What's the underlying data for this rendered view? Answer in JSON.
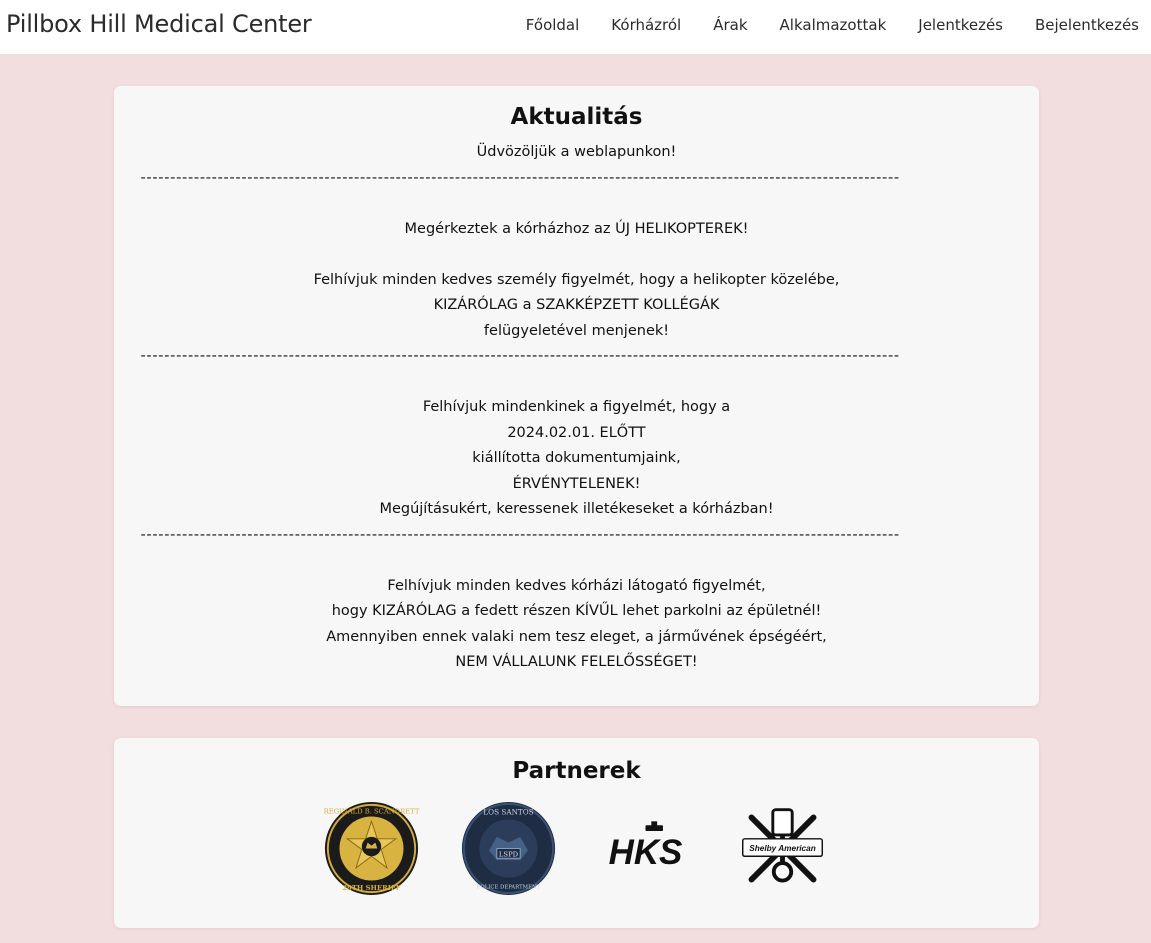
{
  "nav": {
    "brand": "Pillbox Hill Medical Center",
    "items": [
      {
        "label": "Főoldal"
      },
      {
        "label": "Kórházról"
      },
      {
        "label": "Árak"
      },
      {
        "label": "Alkalmazottak"
      },
      {
        "label": "Jelentkezés"
      },
      {
        "label": "Bejelentkezés"
      }
    ]
  },
  "news": {
    "title": "Aktualitás",
    "welcome": "Üdvözöljük a weblapunkon!",
    "divider": "--------------------------------------------------------------------------------------------------------------------------------",
    "block1": {
      "line1": "Megérkeztek a kórházhoz az ÚJ HELIKOPTEREK!",
      "line2": "Felhívjuk minden kedves személy figyelmét, hogy a helikopter közelébe,",
      "line3": "KIZÁRÓLAG a SZAKKÉPZETT KOLLÉGÁK",
      "line4": "felügyeletével menjenek!"
    },
    "block2": {
      "line1": "Felhívjuk mindenkinek a figyelmét, hogy a",
      "line2": "2024.02.01. ELŐTT",
      "line3": "kiállította dokumentumjaink,",
      "line4": "ÉRVÉNYTELENEK!",
      "line5": "Megújításukért, keressenek illetékeseket a kórházban!"
    },
    "block3": {
      "line1": "Felhívjuk minden kedves kórházi látogató figyelmét,",
      "line2": "hogy KIZÁRÓLAG a fedett részen KÍVŰL lehet parkolni az épületnél!",
      "line3": "Amennyiben ennek valaki nem tesz eleget, a járművének épségéért,",
      "line4": "NEM VÁLLALUNK FELELŐSSÉGET!"
    }
  },
  "partners": {
    "title": "Partnerek",
    "logos": [
      {
        "icon": "sheriff-badge-icon",
        "text_top": "REGINALD B. SCANDRETT",
        "text_bottom": "29TH SHERIFF"
      },
      {
        "icon": "police-seal-icon",
        "text_top": "LOS SANTOS",
        "text_center": "LSPD",
        "text_bottom": "POLICE DEPARTMENT"
      },
      {
        "icon": "hks-logo-icon",
        "text_center": "HKS"
      },
      {
        "icon": "shelby-american-logo-icon",
        "text_center": "Shelby American"
      }
    ]
  },
  "colors": {
    "background": "#f3dedf",
    "card": "#f7f7f7",
    "navbar": "#ffffff",
    "text": "#111111",
    "sheriff_gold": "#c9a227",
    "police_navy": "#1e2d44"
  }
}
